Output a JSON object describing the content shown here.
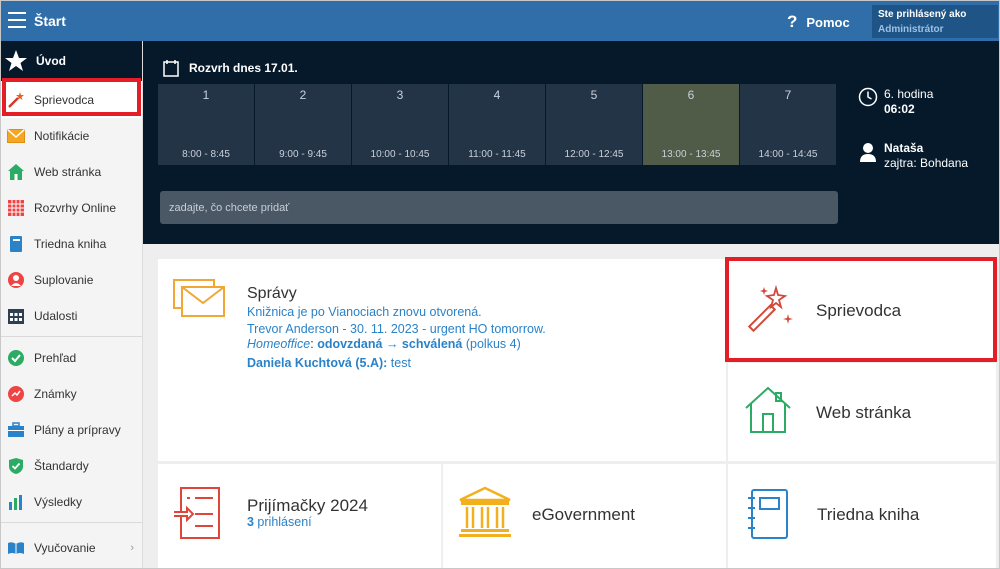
{
  "topbar": {
    "title": "Štart",
    "help_label": "Pomoc",
    "help_icon": "?",
    "user_line1": "Ste prihlásený ako",
    "user_line2": "Administrátor"
  },
  "sidebar": {
    "home_label": "Úvod",
    "items": [
      {
        "label": "Sprievodca",
        "icon": "magic-wand-icon"
      },
      {
        "label": "Notifikácie",
        "icon": "envelope-icon"
      },
      {
        "label": "Web stránka",
        "icon": "house-icon"
      },
      {
        "label": "Rozvrhy Online",
        "icon": "timetable-icon"
      },
      {
        "label": "Triedna kniha",
        "icon": "book-icon"
      },
      {
        "label": "Suplovanie",
        "icon": "substitute-icon"
      },
      {
        "label": "Udalosti",
        "icon": "calendar-icon"
      },
      {
        "label": "Prehľad",
        "icon": "check-circle-icon"
      },
      {
        "label": "Známky",
        "icon": "grades-icon"
      },
      {
        "label": "Plány a prípravy",
        "icon": "briefcase-icon"
      },
      {
        "label": "Štandardy",
        "icon": "shield-check-icon"
      },
      {
        "label": "Výsledky",
        "icon": "bar-chart-icon"
      },
      {
        "label": "Vyučovanie",
        "icon": "open-book-icon"
      }
    ]
  },
  "schedule": {
    "title": "Rozvrh dnes 17.01.",
    "slots": [
      {
        "num": "1",
        "time": "8:00 - 8:45"
      },
      {
        "num": "2",
        "time": "9:00 - 9:45"
      },
      {
        "num": "3",
        "time": "10:00 - 10:45"
      },
      {
        "num": "4",
        "time": "11:00 - 11:45"
      },
      {
        "num": "5",
        "time": "12:00 - 12:45"
      },
      {
        "num": "6",
        "time": "13:00 - 13:45"
      },
      {
        "num": "7",
        "time": "14:00 - 14:45"
      }
    ],
    "current_slot": "6",
    "add_placeholder": "zadajte, čo chcete pridať",
    "clock_hour": "6. hodina",
    "clock_time": "06:02",
    "user_name": "Nataša",
    "user_tomorrow": "zajtra: Bohdana"
  },
  "news": {
    "title": "Správy",
    "line1": "Knižnica je po Vianociach znovu otvorená.",
    "line2": "Trevor Anderson - 30. 11. 2023 - urgent HO tomorrow.",
    "line3_prefix": "Homeoffice",
    "line3_sep": ": ",
    "line3_status": "odovzdaná → schválená",
    "line3_suffix": " (polkus 4)",
    "line4_name": "Daniela Kuchtová (5.A):",
    "line4_text": " test"
  },
  "tiles": {
    "sprievodca": "Sprievodca",
    "web": "Web stránka",
    "prijimacky": "Prijímačky 2024",
    "prijimacky_count": "3",
    "prijimacky_sub": " prihlásení",
    "egov": "eGovernment",
    "triedna": "Triedna kniha"
  },
  "colors": {
    "topbar": "#2f6ea8",
    "dark_panel": "#05192b",
    "highlight": "#e41e26",
    "link": "#2a82c9"
  }
}
